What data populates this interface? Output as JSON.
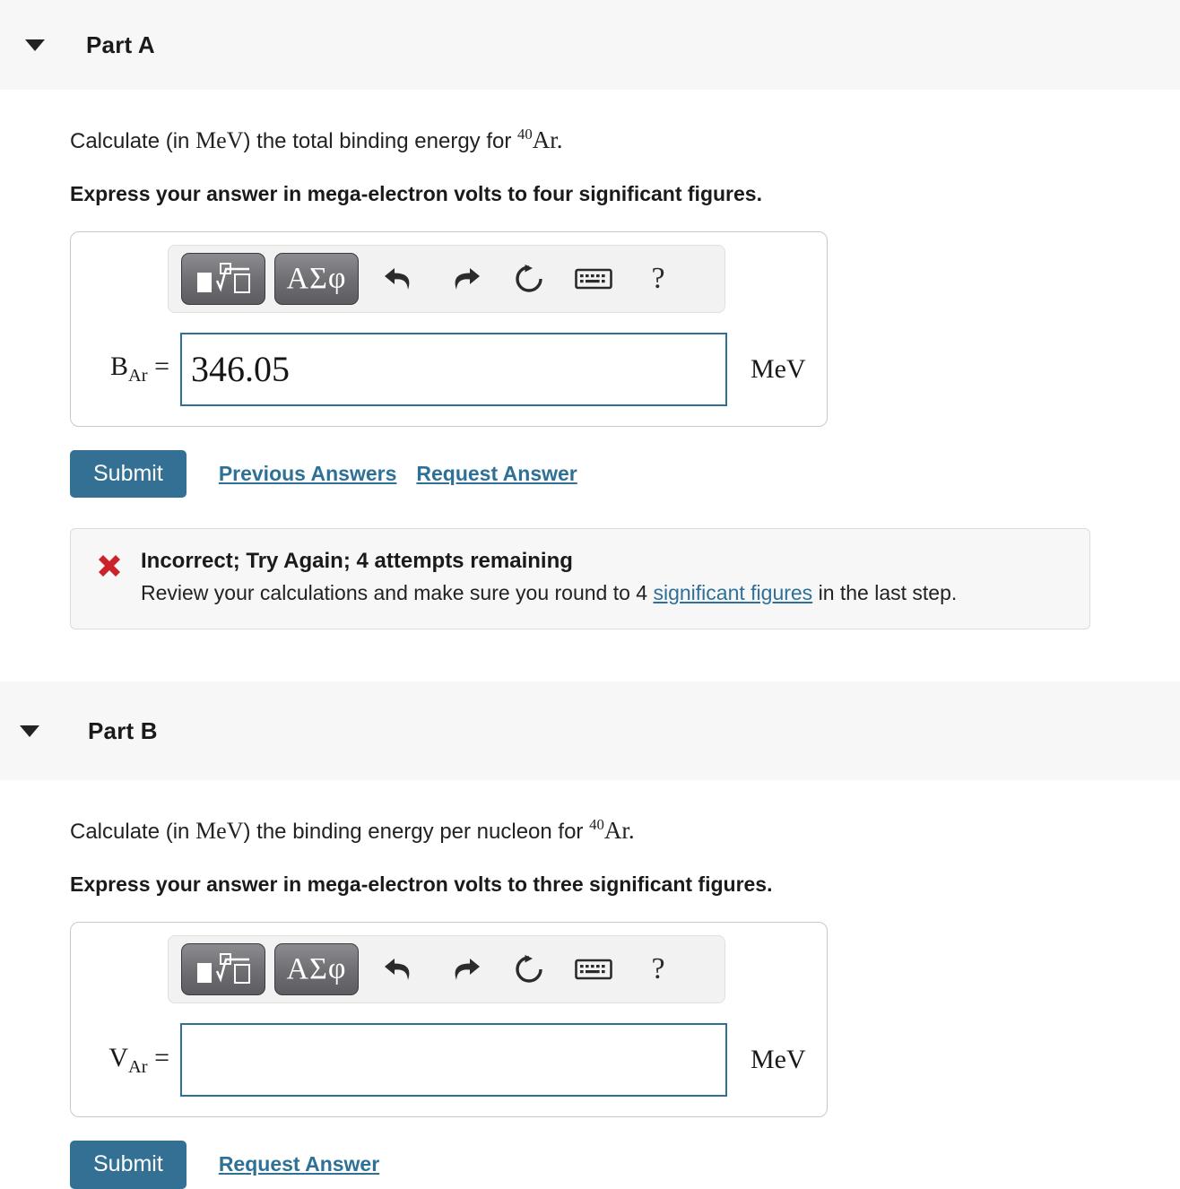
{
  "parts": [
    {
      "header_label": "Part A",
      "caret_icon": "chevron-down-icon",
      "question_prefix": "Calculate (in ",
      "question_unit": "MeV",
      "question_middle": ") the total binding energy for ",
      "isotope_mass": "40",
      "isotope_symbol": "Ar",
      "question_suffix": ".",
      "instruction": "Express your answer in mega-electron volts to four significant figures.",
      "toolbar": {
        "math_template_button": "math-template-icon",
        "greek_button": "ΑΣφ",
        "undo": "undo-icon",
        "redo": "redo-icon",
        "reset": "reset-icon",
        "keyboard": "keyboard-icon",
        "help": "?"
      },
      "input": {
        "variable": "B",
        "subscript": "Ar",
        "equals": "=",
        "value": "346.05",
        "placeholder": "",
        "unit": "MeV"
      },
      "buttons": {
        "submit": "Submit",
        "previous_answers": "Previous Answers",
        "request_answer": "Request Answer"
      },
      "feedback": {
        "icon": "x-mark-icon",
        "headline": "Incorrect; Try Again; 4 attempts remaining",
        "body_before": "Review your calculations and make sure you round to 4 ",
        "body_link": "significant figures",
        "body_after": " in the last step."
      }
    },
    {
      "header_label": "Part B",
      "caret_icon": "chevron-down-icon",
      "question_prefix": "Calculate (in ",
      "question_unit": "MeV",
      "question_middle": ") the binding energy per nucleon for ",
      "isotope_mass": "40",
      "isotope_symbol": "Ar",
      "question_suffix": ".",
      "instruction": "Express your answer in mega-electron volts to three significant figures.",
      "toolbar": {
        "math_template_button": "math-template-icon",
        "greek_button": "ΑΣφ",
        "undo": "undo-icon",
        "redo": "redo-icon",
        "reset": "reset-icon",
        "keyboard": "keyboard-icon",
        "help": "?"
      },
      "input": {
        "variable": "V",
        "subscript": "Ar",
        "equals": "=",
        "value": "",
        "placeholder": "",
        "unit": "MeV"
      },
      "buttons": {
        "submit": "Submit",
        "request_answer": "Request Answer"
      }
    }
  ],
  "colors": {
    "accent": "#337093",
    "link": "#2e7096",
    "error": "#cc2229",
    "header_band": "#f7f7f7",
    "input_border": "#2e7096"
  }
}
